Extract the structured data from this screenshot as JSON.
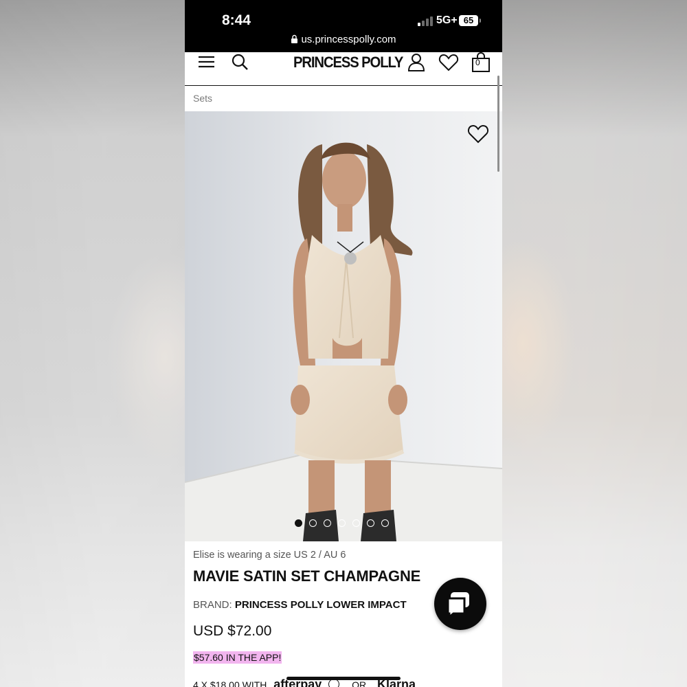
{
  "status_bar": {
    "time": "8:44",
    "network": "5G+",
    "battery": "65"
  },
  "browser": {
    "url": "us.princesspolly.com"
  },
  "header": {
    "logo": "PRINCESS POLLY",
    "bag_count": "0",
    "icons": [
      "menu-icon",
      "search-icon",
      "account-icon",
      "wishlist-icon",
      "bag-icon"
    ]
  },
  "breadcrumb": {
    "label": "Sets"
  },
  "gallery": {
    "image_count": 7,
    "active_index": 0
  },
  "product": {
    "model_note": "Elise is wearing a size US 2 / AU 6",
    "title": "MAVIE SATIN SET CHAMPAGNE",
    "brand_label": "BRAND:",
    "brand_value": "PRINCESS POLLY LOWER IMPACT",
    "price": "USD $72.00",
    "app_price": "$57.60 IN THE APP!",
    "installments": {
      "text": "4 X $18.00 WITH",
      "afterpay": "afterpay",
      "or": "OR",
      "klarna": "Klarna"
    }
  },
  "colors": {
    "app_price_highlight": "#f2b5ef",
    "chat_button": "#0b0b0b"
  }
}
